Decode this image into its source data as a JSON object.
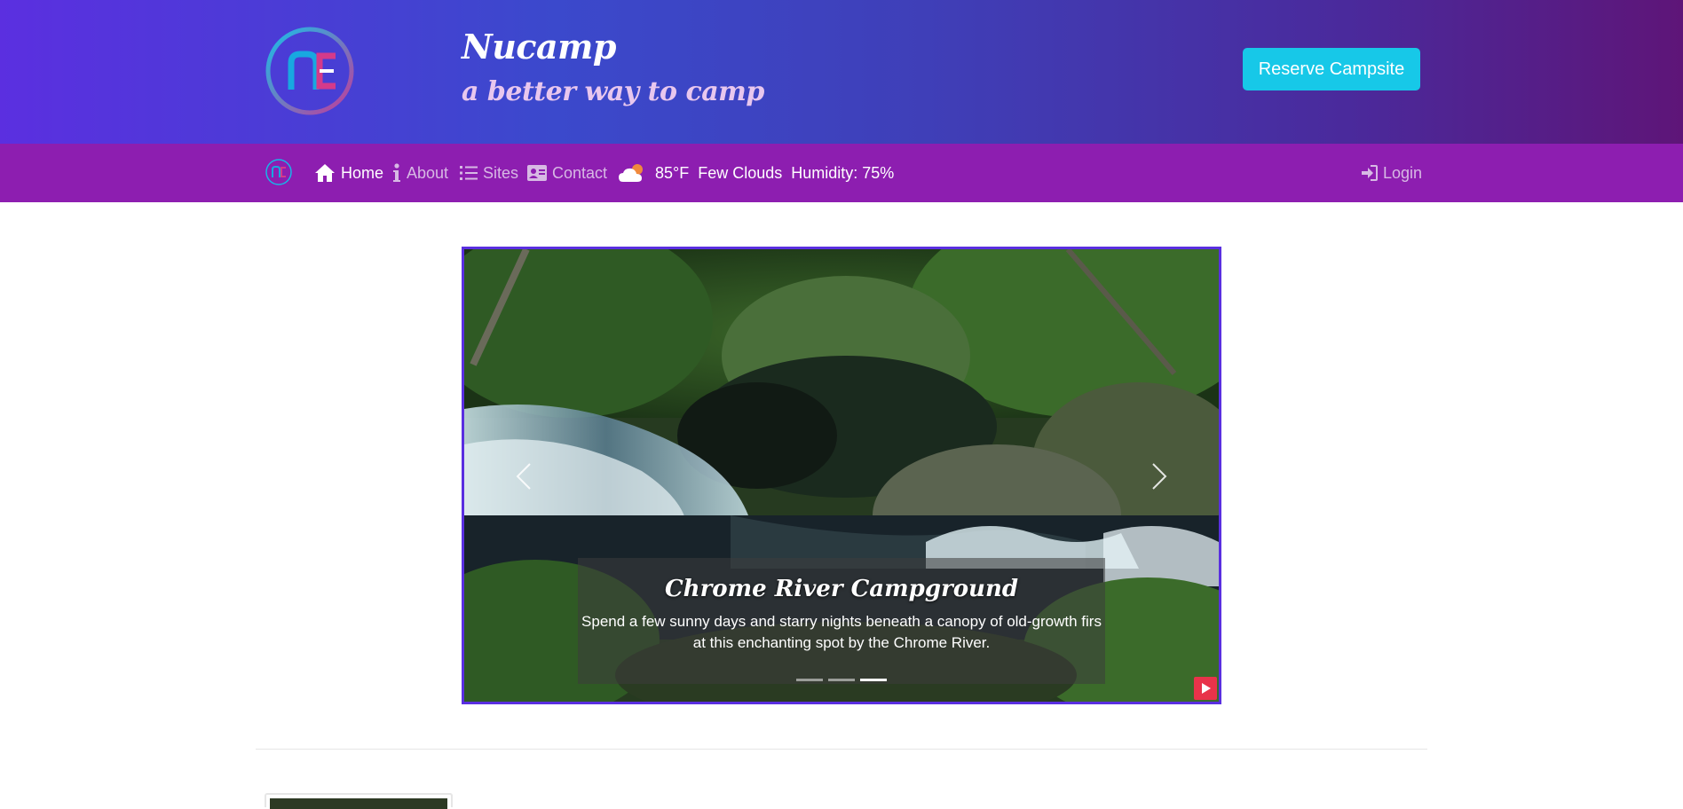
{
  "header": {
    "brand_title": "Nucamp",
    "tagline": "a better way to camp",
    "logo_icon": "nucamp-logo",
    "reserve_button": "Reserve Campsite"
  },
  "nav": {
    "items": [
      {
        "label": "Home",
        "icon": "home-icon",
        "active": true
      },
      {
        "label": "About",
        "icon": "info-icon",
        "active": false
      },
      {
        "label": "Sites",
        "icon": "list-icon",
        "active": false
      },
      {
        "label": "Contact",
        "icon": "address-card-icon",
        "active": false
      }
    ],
    "weather": {
      "icon": "cloud-sun-icon",
      "temperature": "85°F",
      "description": "Few Clouds",
      "humidity": "Humidity: 75%"
    },
    "login": "Login"
  },
  "carousel": {
    "caption_title": "Chrome River Campground",
    "caption_text": "Spend a few sunny days and starry nights beneath a canopy of old-growth firs at this enchanting spot by the Chrome River.",
    "slide_count": 3,
    "active_slide": 3,
    "prev_icon": "chevron-left-icon",
    "next_icon": "chevron-right-icon",
    "play_icon": "play-icon"
  },
  "colors": {
    "header_start": "#5b2fe0",
    "header_end": "#5e1578",
    "nav_bg": "#8d1eb0",
    "accent_button": "#17c8e8",
    "carousel_border": "#5a2fe0",
    "play_button": "#e8334a"
  }
}
